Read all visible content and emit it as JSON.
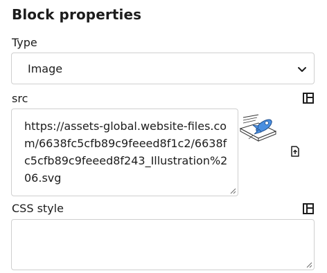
{
  "panel": {
    "title": "Block properties"
  },
  "type_field": {
    "label": "Type",
    "selected": "Image"
  },
  "src_field": {
    "label": "src",
    "value": "https://assets-global.website-files.com/6638fc5cfb89c9feeed8f1c2/6638fc5cfb89c9feeed8f243_Illustration%206.svg"
  },
  "css_field": {
    "label": "CSS style",
    "value": ""
  },
  "icons": {
    "expand_panel": "layout-panel-icon",
    "select_arrow": "chevron-down-icon",
    "file_upload": "file-upload-icon",
    "preview": "rocket-illustration"
  },
  "colors": {
    "text": "#1c1c1c",
    "border": "#cfcfcf",
    "rocket_blue": "#4a8fe0"
  }
}
